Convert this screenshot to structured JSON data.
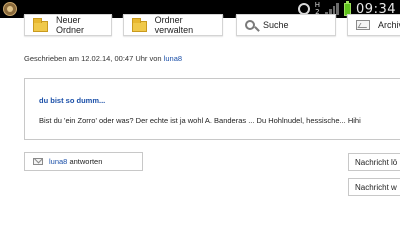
{
  "status_bar": {
    "time": "09:34",
    "network_h": "H",
    "network_level": "2",
    "icons": [
      "notification-app-icon",
      "alarm-icon",
      "signal-icon",
      "battery-icon"
    ],
    "battery_color": "#5fc21e"
  },
  "toolbar": {
    "new_folder": "Neuer Ordner",
    "manage_folders": "Ordner verwalten",
    "search": "Suche",
    "archive": "Archiv"
  },
  "post": {
    "meta_prefix": "Geschrieben am 12.02.14, 00:47 Uhr von",
    "author": "luna8",
    "subject": "du bist so dumm...",
    "body": "Bist du 'ein Zorro' oder was? Der echte ist ja wohl A. Banderas ... Du Hohlnudel, hessische... Hihi"
  },
  "reply": {
    "user": "luna8",
    "label": "antworten"
  },
  "actions": {
    "delete_message": "Nachricht lö",
    "forward_message": "Nachricht w"
  },
  "colors": {
    "link": "#1a4fa8",
    "border": "#c8c8c8"
  }
}
